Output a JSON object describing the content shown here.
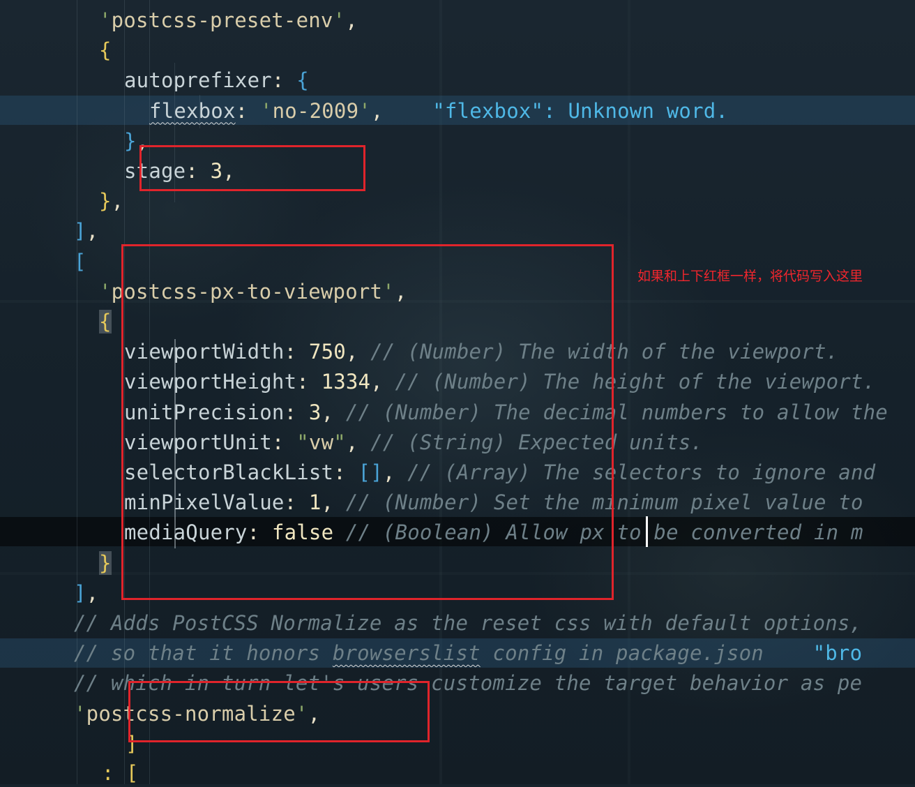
{
  "editor": {
    "lines": [
      {
        "indent": "    ",
        "parts": [
          [
            "c-quote",
            "'"
          ],
          [
            "c-str",
            "postcss-preset-env"
          ],
          [
            "c-quote",
            "'"
          ],
          [
            "c-punc",
            ","
          ]
        ]
      },
      {
        "indent": "    ",
        "parts": [
          [
            "c-bracket",
            "{"
          ]
        ]
      },
      {
        "indent": "      ",
        "parts": [
          [
            "c-key",
            "autoprefixer"
          ],
          [
            "c-punc",
            ": "
          ],
          [
            "c-bracket2",
            "{"
          ]
        ]
      },
      {
        "indent": "        ",
        "parts": [
          [
            "c-key squiggle",
            "flexbox"
          ],
          [
            "c-punc",
            ": "
          ],
          [
            "c-quote",
            "'"
          ],
          [
            "c-str",
            "no-2009"
          ],
          [
            "c-quote",
            "'"
          ],
          [
            "c-punc",
            ","
          ],
          [
            "c-punc",
            "    "
          ],
          [
            "c-err",
            "\"flexbox\": Unknown word."
          ]
        ]
      },
      {
        "indent": "      ",
        "parts": [
          [
            "c-bracket2",
            "}"
          ],
          [
            "c-punc",
            ","
          ]
        ]
      },
      {
        "indent": "      ",
        "parts": [
          [
            "c-key",
            "stage"
          ],
          [
            "c-punc",
            ": "
          ],
          [
            "c-num",
            "3"
          ],
          [
            "c-punc",
            ","
          ]
        ]
      },
      {
        "indent": "    ",
        "parts": [
          [
            "c-bracket",
            "}"
          ],
          [
            "c-punc",
            ","
          ]
        ]
      },
      {
        "indent": "  ",
        "parts": [
          [
            "c-bracket2",
            "]"
          ],
          [
            "c-punc",
            ","
          ]
        ]
      },
      {
        "indent": "  ",
        "parts": [
          [
            "c-bracket2",
            "["
          ]
        ]
      },
      {
        "indent": "    ",
        "parts": [
          [
            "c-quote",
            "'"
          ],
          [
            "c-str",
            "postcss-px-to-viewport"
          ],
          [
            "c-quote",
            "'"
          ],
          [
            "c-punc",
            ","
          ]
        ]
      },
      {
        "indent": "    ",
        "parts": [
          [
            "c-bracket match-bg",
            "{"
          ]
        ]
      },
      {
        "indent": "      ",
        "parts": [
          [
            "c-key",
            "viewportWidth"
          ],
          [
            "c-punc",
            ": "
          ],
          [
            "c-num",
            "750"
          ],
          [
            "c-punc",
            ", "
          ],
          [
            "c-comment",
            "// (Number) The width of the viewport."
          ]
        ]
      },
      {
        "indent": "      ",
        "parts": [
          [
            "c-key",
            "viewportHeight"
          ],
          [
            "c-punc",
            ": "
          ],
          [
            "c-num",
            "1334"
          ],
          [
            "c-punc",
            ", "
          ],
          [
            "c-comment",
            "// (Number) The height of the viewport."
          ]
        ]
      },
      {
        "indent": "      ",
        "parts": [
          [
            "c-key",
            "unitPrecision"
          ],
          [
            "c-punc",
            ": "
          ],
          [
            "c-num",
            "3"
          ],
          [
            "c-punc",
            ", "
          ],
          [
            "c-comment",
            "// (Number) The decimal numbers to allow the"
          ]
        ]
      },
      {
        "indent": "      ",
        "parts": [
          [
            "c-key",
            "viewportUnit"
          ],
          [
            "c-punc",
            ": "
          ],
          [
            "c-quote",
            "\""
          ],
          [
            "c-str",
            "vw"
          ],
          [
            "c-quote",
            "\""
          ],
          [
            "c-punc",
            ", "
          ],
          [
            "c-comment",
            "// (String) Expected units."
          ]
        ]
      },
      {
        "indent": "      ",
        "parts": [
          [
            "c-key",
            "selectorBlackList"
          ],
          [
            "c-punc",
            ": "
          ],
          [
            "c-bracket2",
            "[]"
          ],
          [
            "c-punc",
            ", "
          ],
          [
            "c-comment",
            "// (Array) The selectors to ignore and"
          ]
        ]
      },
      {
        "indent": "      ",
        "parts": [
          [
            "c-key",
            "minPixelValue"
          ],
          [
            "c-punc",
            ": "
          ],
          [
            "c-num",
            "1"
          ],
          [
            "c-punc",
            ", "
          ],
          [
            "c-comment",
            "// (Number) Set the minimum pixel value to"
          ]
        ]
      },
      {
        "indent": "      ",
        "parts": [
          [
            "c-key",
            "mediaQuery"
          ],
          [
            "c-punc",
            ": "
          ],
          [
            "c-bool",
            "false"
          ],
          [
            "c-punc",
            " "
          ],
          [
            "c-comment",
            "// (Boolean) Allow px to be converted in m"
          ]
        ]
      },
      {
        "indent": "    ",
        "parts": [
          [
            "c-bracket match-bg",
            "}"
          ]
        ]
      },
      {
        "indent": "  ",
        "parts": [
          [
            "c-bracket2",
            "]"
          ],
          [
            "c-punc",
            ","
          ]
        ]
      },
      {
        "indent": "  ",
        "parts": [
          [
            "c-comment",
            "// Adds PostCSS Normalize as the reset css with default options,"
          ]
        ]
      },
      {
        "indent": "  ",
        "parts": [
          [
            "c-comment",
            "// so that it honors "
          ],
          [
            "c-comment squiggle",
            "browserslist"
          ],
          [
            "c-comment",
            " config in package.json"
          ],
          [
            "c-punc",
            "    "
          ],
          [
            "c-err",
            "\"bro"
          ]
        ]
      },
      {
        "indent": "  ",
        "parts": [
          [
            "c-comment",
            "// which in turn let's users customize the target behavior as pe"
          ]
        ]
      },
      {
        "indent": "  ",
        "parts": [
          [
            "c-quote",
            "'"
          ],
          [
            "c-str",
            "postcss-normalize"
          ],
          [
            "c-quote",
            "'"
          ],
          [
            "c-punc",
            ","
          ]
        ]
      }
    ],
    "gutter_tail": [
      {
        "text": "]"
      },
      {
        "text": ": ["
      }
    ]
  },
  "annotation": {
    "note": "如果和上下红框一样，将代码写入这里"
  },
  "colors": {
    "annotation_red": "#e0242b",
    "background": "#17232c"
  }
}
